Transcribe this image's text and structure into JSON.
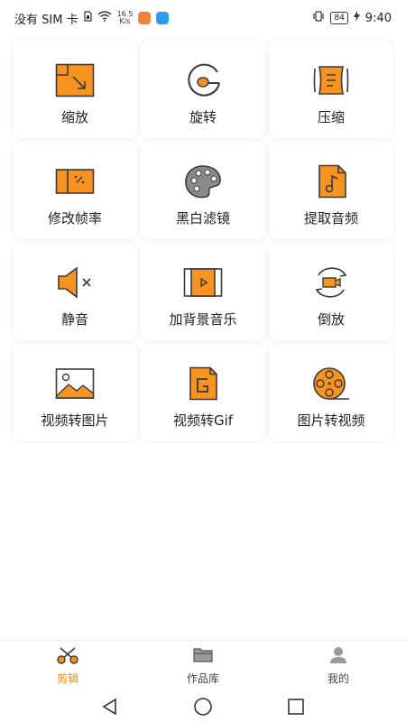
{
  "status_bar": {
    "carrier": "没有 SIM 卡",
    "net_speed_value": "16.5",
    "net_speed_unit": "K/s",
    "battery": "84",
    "time": "9:40"
  },
  "tools": [
    {
      "label": "缩放",
      "icon": "scale-icon"
    },
    {
      "label": "旋转",
      "icon": "rotate-icon"
    },
    {
      "label": "压缩",
      "icon": "compress-icon"
    },
    {
      "label": "修改帧率",
      "icon": "frame-rate-icon"
    },
    {
      "label": "黑白滤镜",
      "icon": "palette-icon"
    },
    {
      "label": "提取音频",
      "icon": "audio-file-icon"
    },
    {
      "label": "静音",
      "icon": "mute-icon"
    },
    {
      "label": "加背景音乐",
      "icon": "background-music-icon"
    },
    {
      "label": "倒放",
      "icon": "reverse-icon"
    },
    {
      "label": "视频转图片",
      "icon": "video-to-image-icon"
    },
    {
      "label": "视频转Gif",
      "icon": "gif-icon"
    },
    {
      "label": "图片转视频",
      "icon": "film-reel-icon"
    }
  ],
  "tabs": [
    {
      "label": "剪辑",
      "active": true,
      "icon": "scissors-icon"
    },
    {
      "label": "作品库",
      "active": false,
      "icon": "folder-icon"
    },
    {
      "label": "我的",
      "active": false,
      "icon": "person-icon"
    }
  ],
  "colors": {
    "accent": "#f08a00",
    "icon_fill": "#f7931e",
    "icon_stroke": "#3a3a3a",
    "active_tab": "#f08a00"
  }
}
